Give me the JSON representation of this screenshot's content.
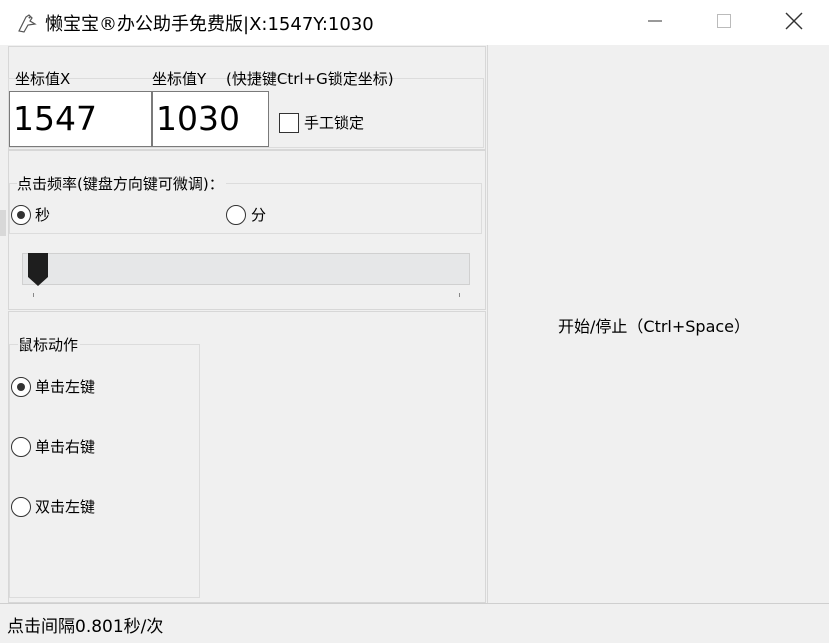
{
  "window": {
    "title": "懒宝宝®办公助手免费版|X:1547Y:1030"
  },
  "coords": {
    "label_x": "坐标值X",
    "label_y": "坐标值Y",
    "lock_hint": "(快捷键Ctrl+G锁定坐标)",
    "value_x": "1547",
    "value_y": "1030",
    "manual_lock_label": "手工锁定",
    "manual_lock_checked": false
  },
  "frequency": {
    "label": "点击频率(键盘方向键可微调)：",
    "unit_seconds": "秒",
    "unit_minutes": "分",
    "selected_unit": "秒",
    "slider_level": 0.02
  },
  "mouse_action": {
    "label": "鼠标动作",
    "options": [
      "单击左键",
      "单击右键",
      "双击左键"
    ],
    "selected": "单击左键"
  },
  "actions": {
    "start_stop_label": "开始/停止（Ctrl+Space）"
  },
  "status": {
    "text": "点击间隔0.801秒/次"
  }
}
